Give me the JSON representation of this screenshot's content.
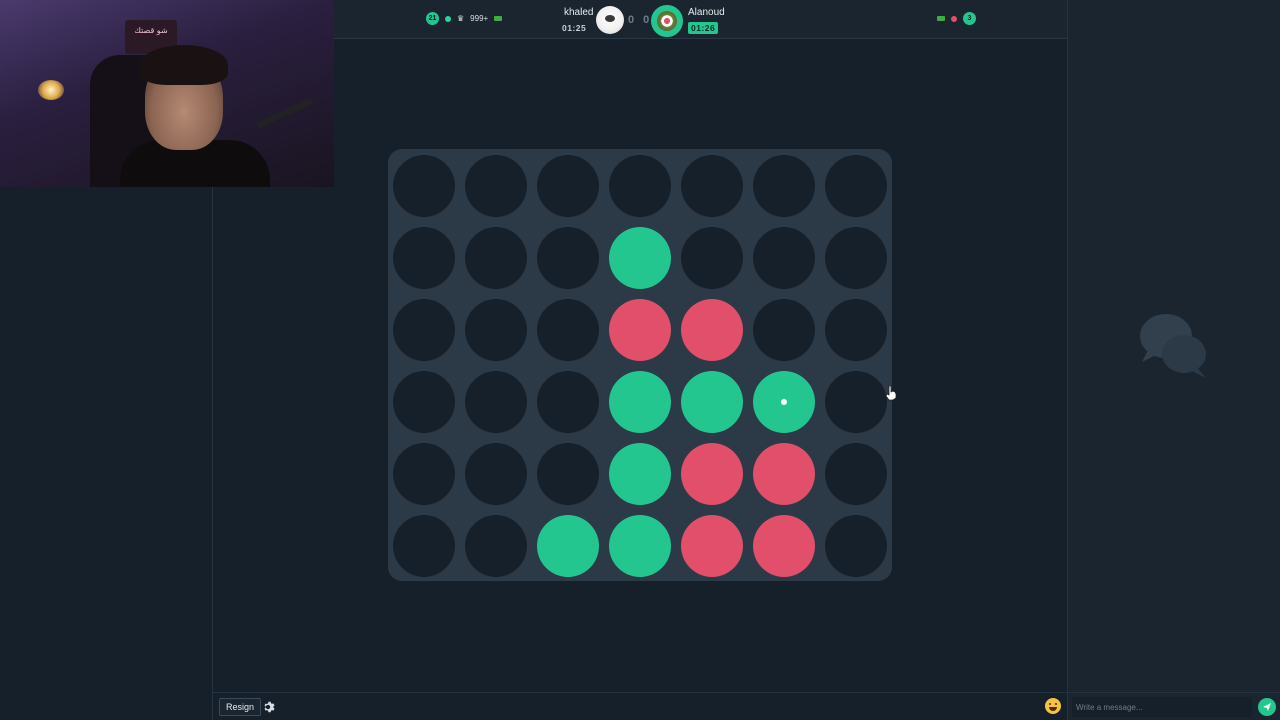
{
  "header": {
    "left": {
      "level_badge": "21",
      "rank": "999+"
    },
    "player1": {
      "name": "khaled",
      "time": "01:25"
    },
    "score": "0 0",
    "player2": {
      "name": "Alanoud",
      "time": "01:26"
    },
    "right": {
      "level_badge": "3"
    }
  },
  "board": {
    "columns": 7,
    "rows": 6,
    "cells": [
      [
        "empty",
        "empty",
        "empty",
        "empty",
        "empty",
        "empty",
        "empty"
      ],
      [
        "empty",
        "empty",
        "empty",
        "green",
        "empty",
        "empty",
        "empty"
      ],
      [
        "empty",
        "empty",
        "empty",
        "red",
        "red",
        "empty",
        "empty"
      ],
      [
        "empty",
        "empty",
        "empty",
        "green",
        "green",
        "green-last",
        "empty"
      ],
      [
        "empty",
        "empty",
        "empty",
        "green",
        "red",
        "red",
        "empty"
      ],
      [
        "empty",
        "empty",
        "green",
        "green",
        "red",
        "red",
        "empty"
      ]
    ],
    "colors": {
      "green": "#24c690",
      "red": "#e24f6b",
      "empty": "#16202b",
      "board": "#2c3a48"
    }
  },
  "footer": {
    "resign_label": "Resign"
  },
  "chat": {
    "placeholder": "Write a message..."
  },
  "webcam": {
    "sign_text": "شو قصتك"
  }
}
